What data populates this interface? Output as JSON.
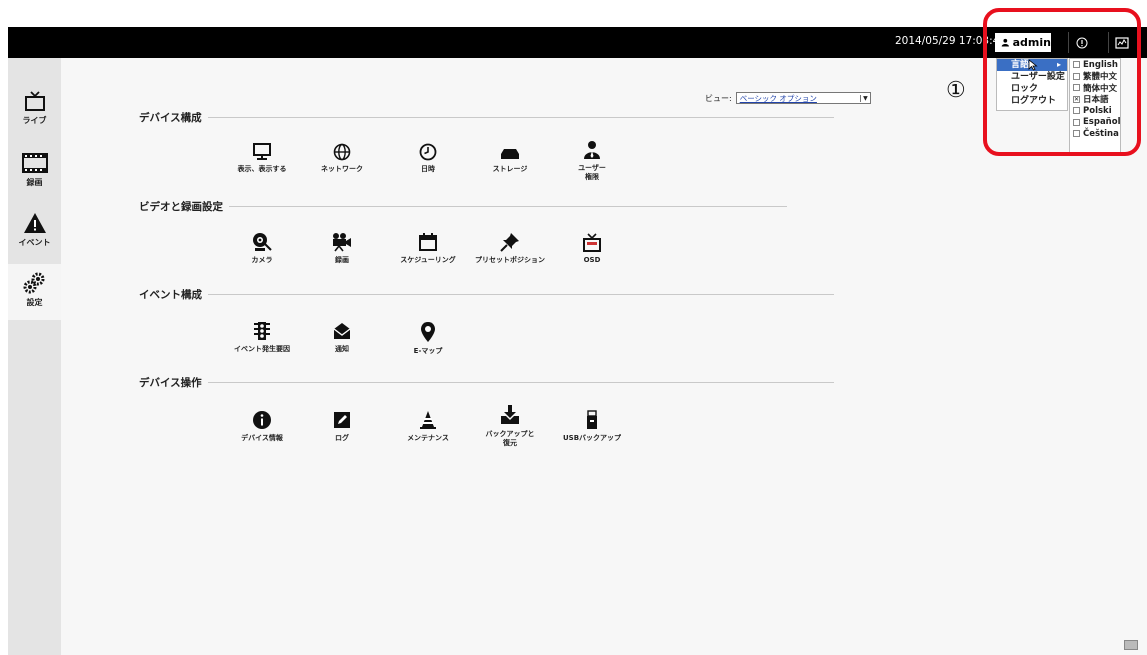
{
  "topbar": {
    "datetime": "2014/05/29 17:03:4",
    "user_label": "admin",
    "icons": [
      "user-icon",
      "alert-icon",
      "monitor-icon"
    ]
  },
  "sidebar": {
    "items": [
      {
        "label": "ライブ",
        "icon": "tv-icon"
      },
      {
        "label": "録画",
        "icon": "film-icon"
      },
      {
        "label": "イベント",
        "icon": "warning-icon"
      },
      {
        "label": "設定",
        "icon": "gears-icon"
      }
    ],
    "active": "設定"
  },
  "view": {
    "label": "ビュー:",
    "value": "ベーシック オプション"
  },
  "sections": [
    {
      "title": "デバイス構成",
      "tiles": [
        {
          "label": "表示、表示する",
          "icon": "display-icon"
        },
        {
          "label": "ネットワーク",
          "icon": "globe-icon"
        },
        {
          "label": "日時",
          "icon": "clock-icon"
        },
        {
          "label": "ストレージ",
          "icon": "storage-icon"
        },
        {
          "label": "ユーザー\n権限",
          "icon": "user-icon"
        }
      ]
    },
    {
      "title": "ビデオと録画設定",
      "tiles": [
        {
          "label": "カメラ",
          "icon": "camera-icon"
        },
        {
          "label": "録画",
          "icon": "video-camera-icon"
        },
        {
          "label": "スケジューリング",
          "icon": "calendar-icon"
        },
        {
          "label": "プリセットポジション",
          "icon": "pushpin-icon"
        },
        {
          "label": "OSD",
          "icon": "osd-tv-icon"
        }
      ]
    },
    {
      "title": "イベント構成",
      "tiles": [
        {
          "label": "イベント発生要因",
          "icon": "traffic-light-icon"
        },
        {
          "label": "通知",
          "icon": "envelope-icon"
        },
        {
          "label": "E-マップ",
          "icon": "map-pin-icon"
        }
      ]
    },
    {
      "title": "デバイス操作",
      "tiles": [
        {
          "label": "デバイス情報",
          "icon": "info-icon"
        },
        {
          "label": "ログ",
          "icon": "log-edit-icon"
        },
        {
          "label": "メンテナンス",
          "icon": "cone-icon"
        },
        {
          "label": "バックアップと\n復元",
          "icon": "download-tray-icon"
        },
        {
          "label": "USBバックアップ",
          "icon": "usb-drive-icon"
        }
      ]
    }
  ],
  "user_menu": {
    "items": [
      "言語",
      "ユーザー設定",
      "ロック",
      "ログアウト"
    ],
    "selected": "言語"
  },
  "language_menu": {
    "items": [
      {
        "label": "English",
        "checked": false
      },
      {
        "label": "繁體中文",
        "checked": false
      },
      {
        "label": "簡体中文",
        "checked": false
      },
      {
        "label": "日本語",
        "checked": true
      },
      {
        "label": "Polski",
        "checked": false
      },
      {
        "label": "Español",
        "checked": false
      },
      {
        "label": "Čeština",
        "checked": false
      }
    ]
  },
  "annotation": {
    "marker": "①",
    "highlight_color": "#e8101e"
  },
  "colors": {
    "topbar": "#000000",
    "menu_selected": "#3a6fc4",
    "sidebar": "#e4e4e4",
    "main_bg": "#f7f7f7"
  }
}
